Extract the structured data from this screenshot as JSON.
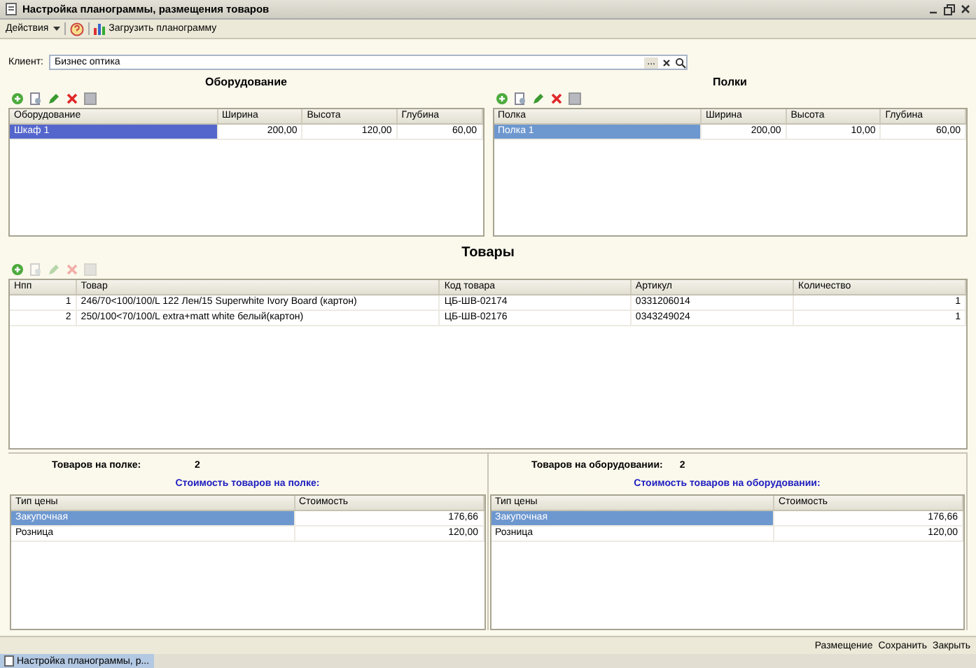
{
  "window": {
    "title": "Настройка планограммы, размещения товаров"
  },
  "toolbar": {
    "actions": "Действия",
    "load": "Загрузить планограмму"
  },
  "client": {
    "label": "Клиент:",
    "value": "Бизнес оптика",
    "select_button": "..."
  },
  "equipment": {
    "title": "Оборудование",
    "toolbar": [
      {
        "kind": "add",
        "disabled": false
      },
      {
        "kind": "copy",
        "disabled": false
      },
      {
        "kind": "edit",
        "disabled": false
      },
      {
        "kind": "delete",
        "disabled": false
      },
      {
        "kind": "save",
        "disabled": false
      }
    ],
    "columns": [
      "Оборудование",
      "Ширина",
      "Высота",
      "Глубина"
    ],
    "rows": [
      {
        "cells": [
          "Шкаф 1",
          "200,00",
          "120,00",
          "60,00"
        ],
        "selected": true
      }
    ]
  },
  "shelves": {
    "title": "Полки",
    "toolbar": [
      {
        "kind": "add",
        "disabled": false
      },
      {
        "kind": "copy",
        "disabled": false
      },
      {
        "kind": "edit",
        "disabled": false
      },
      {
        "kind": "delete",
        "disabled": false
      },
      {
        "kind": "save",
        "disabled": false
      }
    ],
    "columns": [
      "Полка",
      "Ширина",
      "Высота",
      "Глубина"
    ],
    "rows": [
      {
        "cells": [
          "Полка 1",
          "200,00",
          "10,00",
          "60,00"
        ],
        "selected": true
      }
    ]
  },
  "goods": {
    "title": "Товары",
    "toolbar": [
      {
        "kind": "add",
        "disabled": false
      },
      {
        "kind": "copy",
        "disabled": true
      },
      {
        "kind": "edit",
        "disabled": true
      },
      {
        "kind": "delete",
        "disabled": true
      },
      {
        "kind": "save",
        "disabled": true
      }
    ],
    "columns": [
      "Нпп",
      "Товар",
      "Код товара",
      "Артикул",
      "Количество"
    ],
    "rows": [
      {
        "cells": [
          "1",
          "246/70<100/100/L 122 Лен/15 Superwhite Ivory Board (картон)",
          "ЦБ-ШВ-02174",
          "0331206014",
          "1"
        ],
        "selected": false
      },
      {
        "cells": [
          "2",
          "250/100<70/100/L extra+matt white белый(картон)",
          "ЦБ-ШВ-02176",
          "0343249024",
          "1"
        ],
        "selected": false
      }
    ]
  },
  "shelf_summary": {
    "count_label": "Товаров на полке:",
    "count": "2",
    "cost_title": "Стоимость товаров на полке:",
    "columns": [
      "Тип цены",
      "Стоимость"
    ],
    "rows": [
      {
        "cells": [
          "Закупочная",
          "176,66"
        ],
        "selected": true
      },
      {
        "cells": [
          "Розница",
          "120,00"
        ],
        "selected": false
      }
    ]
  },
  "equipment_summary": {
    "count_label": "Товаров на оборудовании:",
    "count": "2",
    "cost_title": "Стоимость товаров на оборудовании:",
    "columns": [
      "Тип цены",
      "Стоимость"
    ],
    "rows": [
      {
        "cells": [
          "Закупочная",
          "176,66"
        ],
        "selected": true
      },
      {
        "cells": [
          "Розница",
          "120,00"
        ],
        "selected": false
      }
    ]
  },
  "footer_buttons": [
    "Размещение",
    "Сохранить",
    "Закрыть"
  ],
  "taskbar": {
    "item": "Настройка планограммы, р..."
  }
}
